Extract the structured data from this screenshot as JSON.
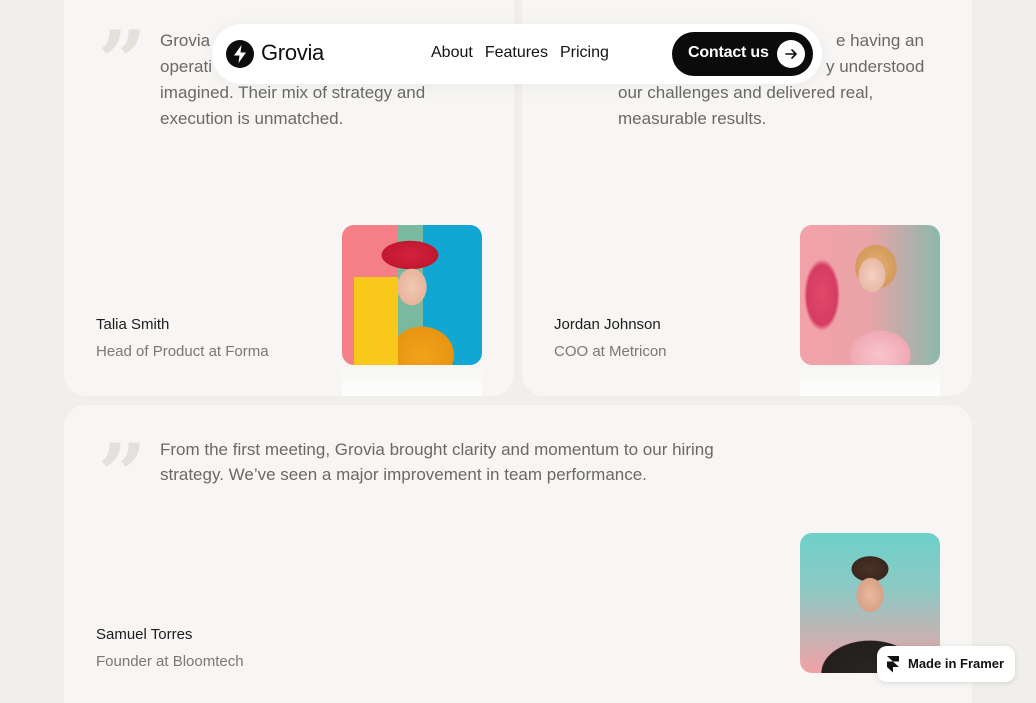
{
  "nav": {
    "logo_text": "Grovia",
    "links": [
      "About",
      "Features",
      "Pricing"
    ],
    "cta_label": "Contact us",
    "cta_icon": "arrow-right-icon"
  },
  "testimonials": [
    {
      "quote_mark": "”",
      "quote_lines": [
        "Grovia",
        "operati",
        "imagined. Their mix of strategy and",
        "execution is unmatched."
      ],
      "name": "Talia Smith",
      "role": "Head of Product at Forma"
    },
    {
      "quote_lines": [
        "e having an",
        "y understood",
        "our challenges and delivered real,",
        "measurable results."
      ],
      "name": "Jordan Johnson",
      "role": "COO at Metricon"
    },
    {
      "quote_mark": "”",
      "quote_lines": [
        "From the first meeting, Grovia brought clarity and momentum to our hiring",
        "strategy. We’ve seen a major improvement in team performance."
      ],
      "name": "Samuel Torres",
      "role": "Founder at Bloomtech"
    }
  ],
  "badge": {
    "label": "Made in Framer",
    "icon": "framer-icon"
  },
  "colors": {
    "page_bg": "#f1efec",
    "card_bg": "#f7f6f4",
    "cta_bg": "#0b0b0b",
    "text_muted": "#6b6966"
  }
}
